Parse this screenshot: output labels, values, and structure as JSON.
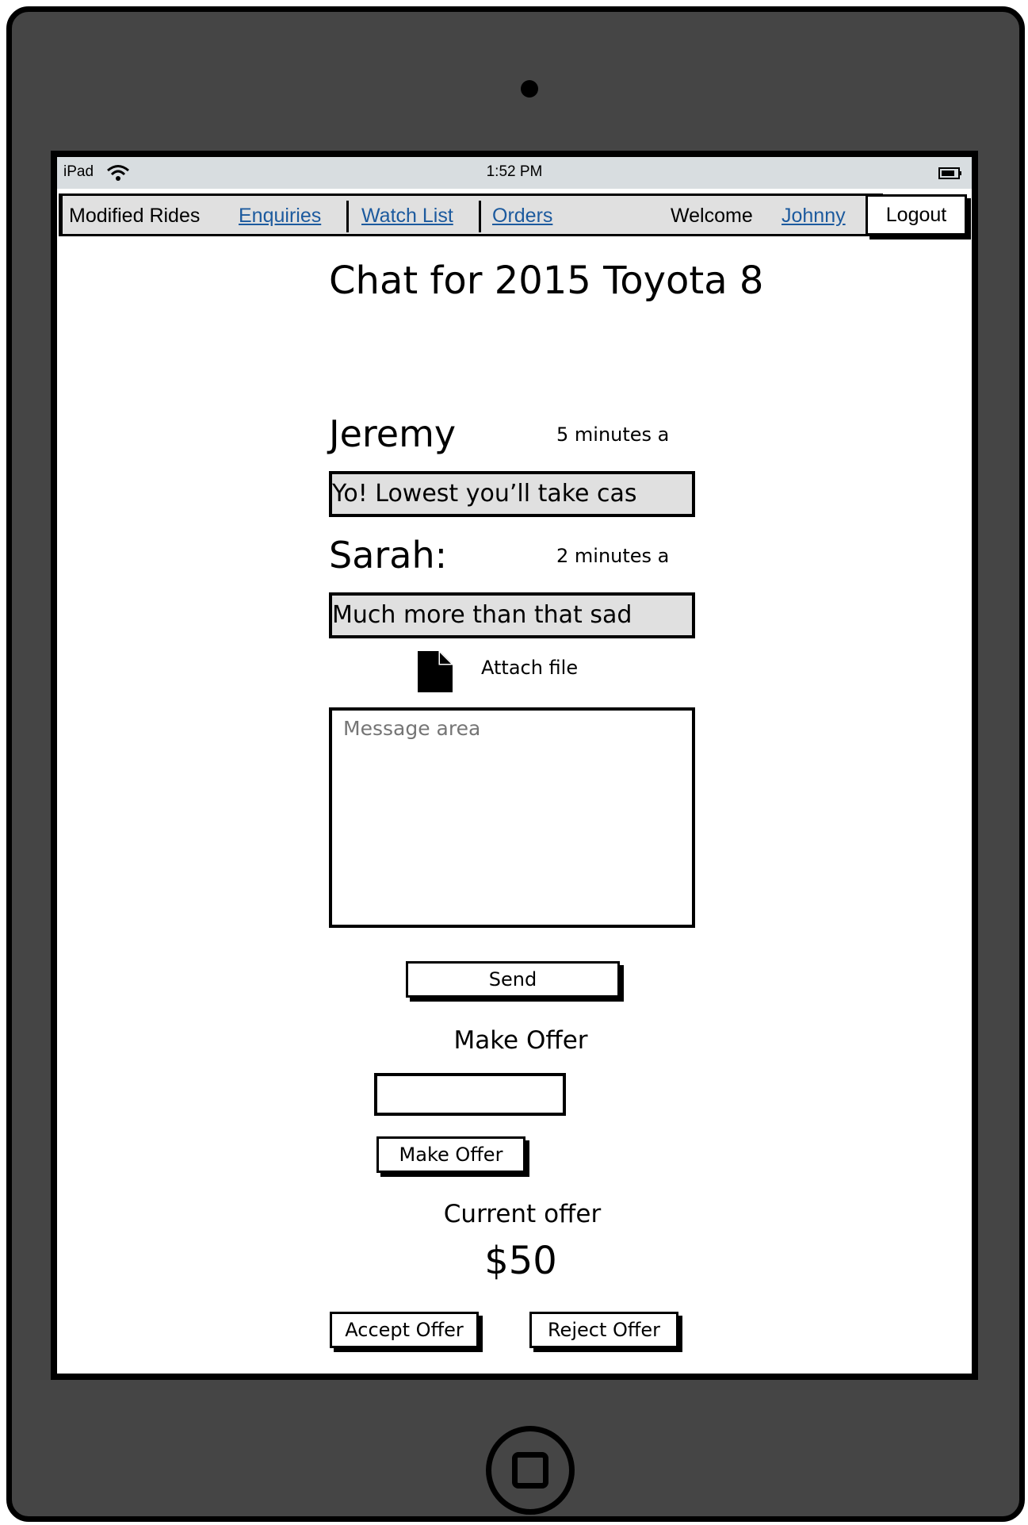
{
  "status_bar": {
    "device": "iPad",
    "time": "1:52 PM"
  },
  "nav": {
    "brand": "Modified Rides",
    "links": [
      "Enquiries",
      "Watch List",
      "Orders"
    ],
    "welcome": "Welcome",
    "user": "Johnny",
    "logout": "Logout"
  },
  "page": {
    "title": "Chat for 2015 Toyota 8"
  },
  "messages": [
    {
      "sender": "Jeremy",
      "time": "5 minutes a",
      "text": "Yo! Lowest you’ll take cas"
    },
    {
      "sender": "Sarah:",
      "time": "2 minutes a",
      "text": "Much more than that sad"
    }
  ],
  "compose": {
    "attach_label": "Attach file",
    "placeholder": "Message area",
    "send_label": "Send"
  },
  "offer": {
    "heading": "Make Offer",
    "input_value": "",
    "button_label": "Make Offer",
    "current_label": "Current offer",
    "current_value": "$50",
    "accept_label": "Accept Offer",
    "reject_label": "Reject Offer"
  },
  "icons": {
    "wifi": "wifi-icon",
    "battery": "battery-icon",
    "file": "file-icon"
  }
}
